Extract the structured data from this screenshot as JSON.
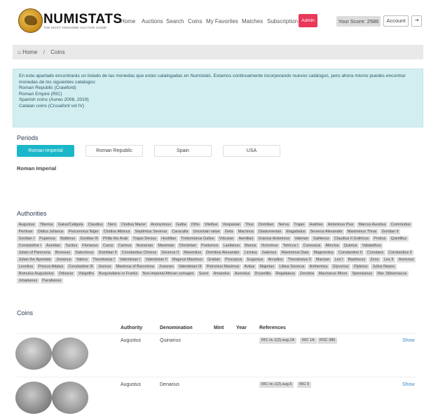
{
  "header": {
    "brand": "NUMISTATS",
    "tagline": "THE MOST AWESOME AUCTION GUIDE",
    "nav": [
      "Home",
      "Auctions",
      "Search",
      "Coins",
      "My Favorites",
      "Matches",
      "Subscription"
    ],
    "admin_label": "Admin",
    "score": "Your Score: 2586",
    "account_label": "Account",
    "logout_icon": "logout-icon"
  },
  "breadcrumb": {
    "home": "Home",
    "current": "Coins"
  },
  "info": {
    "intro": "En este apartado encontrarás un listado de las monedas que estan catalogadas en Numistats. Estamos continuamente incorporando nuevos catálogos, pero ahora mismo puedes encontrar monedas de los siguientes catalogos:",
    "catalogs": [
      "Roman Republic (Crawford)",
      "Roman Empire (RIC)",
      "Spanish coins (Aureo 2008, 2019)",
      "Catalan coins (Crusafont vol IV)"
    ]
  },
  "periods": {
    "title": "Periods",
    "options": [
      "Roman Imperial",
      "Roman Republic",
      "Spain",
      "USA"
    ],
    "selected": "Roman Imperial"
  },
  "authorities": {
    "title": "Authorities",
    "tags": [
      "Augustus",
      "Tiberius",
      "Gaius/Caligula",
      "Claudius",
      "Nero",
      "Clodius Macer",
      "Anonymous",
      "Galba",
      "Otho",
      "Vitellius",
      "Vespasian",
      "Titus",
      "Domitian",
      "Nerva",
      "Trajan",
      "Hadrian",
      "Antoninus Pius",
      "Marcus Aurelius",
      "Commodus",
      "Pertinax",
      "Didius Julianus",
      "Pescennius Niger",
      "Clodius Albinus",
      "Septimius Severus",
      "Caracalla",
      "Uncertain value",
      "Geta",
      "Macrinus",
      "Diadumenian",
      "Elagabalus",
      "Severus Alexander",
      "Maximinus Thrax",
      "Gordian II",
      "Gordian I",
      "Pupienus",
      "Balbinus",
      "Gordian III",
      "Philip the Arab",
      "Trajan Decius",
      "Hostilian",
      "Trebonianus Gallus",
      "Volusian",
      "Aemilian",
      "Uranius Antoninus",
      "Valerian",
      "Gallienus",
      "Claudius II Gothicus",
      "Probus",
      "Quintillus",
      "Constantine I",
      "Aurelian",
      "Tacitus",
      "Florianus",
      "Carus",
      "Carinus",
      "Numerian",
      "Maximian",
      "Diocletian",
      "Postumus",
      "Laelianus",
      "Marius",
      "Victorinus",
      "Tetricus I",
      "Carausius",
      "Allectus",
      "Quietus",
      "Vabalathus",
      "Julian of Pannonia",
      "Bonosus",
      "Saturninus",
      "Domitian II",
      "Constantius Chlorus",
      "Severus II",
      "Maxentius",
      "Domitius Alexander",
      "Licinius",
      "Galerius",
      "Maximinus Daia",
      "Magnentius",
      "Constantine II",
      "Constans",
      "Constantius II",
      "Julian the Apostate",
      "Jovianus",
      "Valens",
      "Theodosius I",
      "Valentinian I",
      "Valentinian II",
      "Magnus Maximus",
      "Gratian",
      "Procopius",
      "Eugenius",
      "Arcadius",
      "Theodosius II",
      "Marcian",
      "Leo I",
      "Basiliscus",
      "Zeno",
      "Leo II",
      "Honorius",
      "Leontius",
      "Priscus Attalus",
      "Constantine III",
      "Jovinus",
      "Maximus of Barcelona",
      "Joannes",
      "Valentinian III",
      "Petronius Maximus",
      "Avitus",
      "Majorian",
      "Libius Severus",
      "Anthemius",
      "Glycerius",
      "Olybrius",
      "Julius Nepos",
      "Romulus Augustulus",
      "Odoacer",
      "Visigoths",
      "Burgundians or Franks",
      "Non-imperial African coinages",
      "Suevi",
      "Amandus",
      "Aureolus",
      "Dryantilla",
      "Regalianus",
      "Zenobia",
      "Macrianus Minor",
      "Sponsianus",
      "Mar. Silbannacus",
      "Jotapianus",
      "Pacatianus"
    ]
  },
  "coins": {
    "title": "Coins",
    "columns": [
      "Authority",
      "Denomination",
      "Mint",
      "Year",
      "References"
    ],
    "rows": [
      {
        "authority": "Augustus",
        "denomination": "Quinarius",
        "mint": "",
        "year": "",
        "references": [
          "RIC ric.1(2).aug.1A",
          "RIC 1A",
          "RSC 386"
        ],
        "action": "Show"
      },
      {
        "authority": "Augustus",
        "denomination": "Denarius",
        "mint": "",
        "year": "",
        "references": [
          "RIC ric.1(2).aug.6",
          "RIC 6"
        ],
        "action": "Show"
      }
    ]
  },
  "colors": {
    "accent": "#1ab6c9",
    "admin": "#e8395a",
    "info_bg": "#d3eef1",
    "link": "#3a88c5"
  }
}
